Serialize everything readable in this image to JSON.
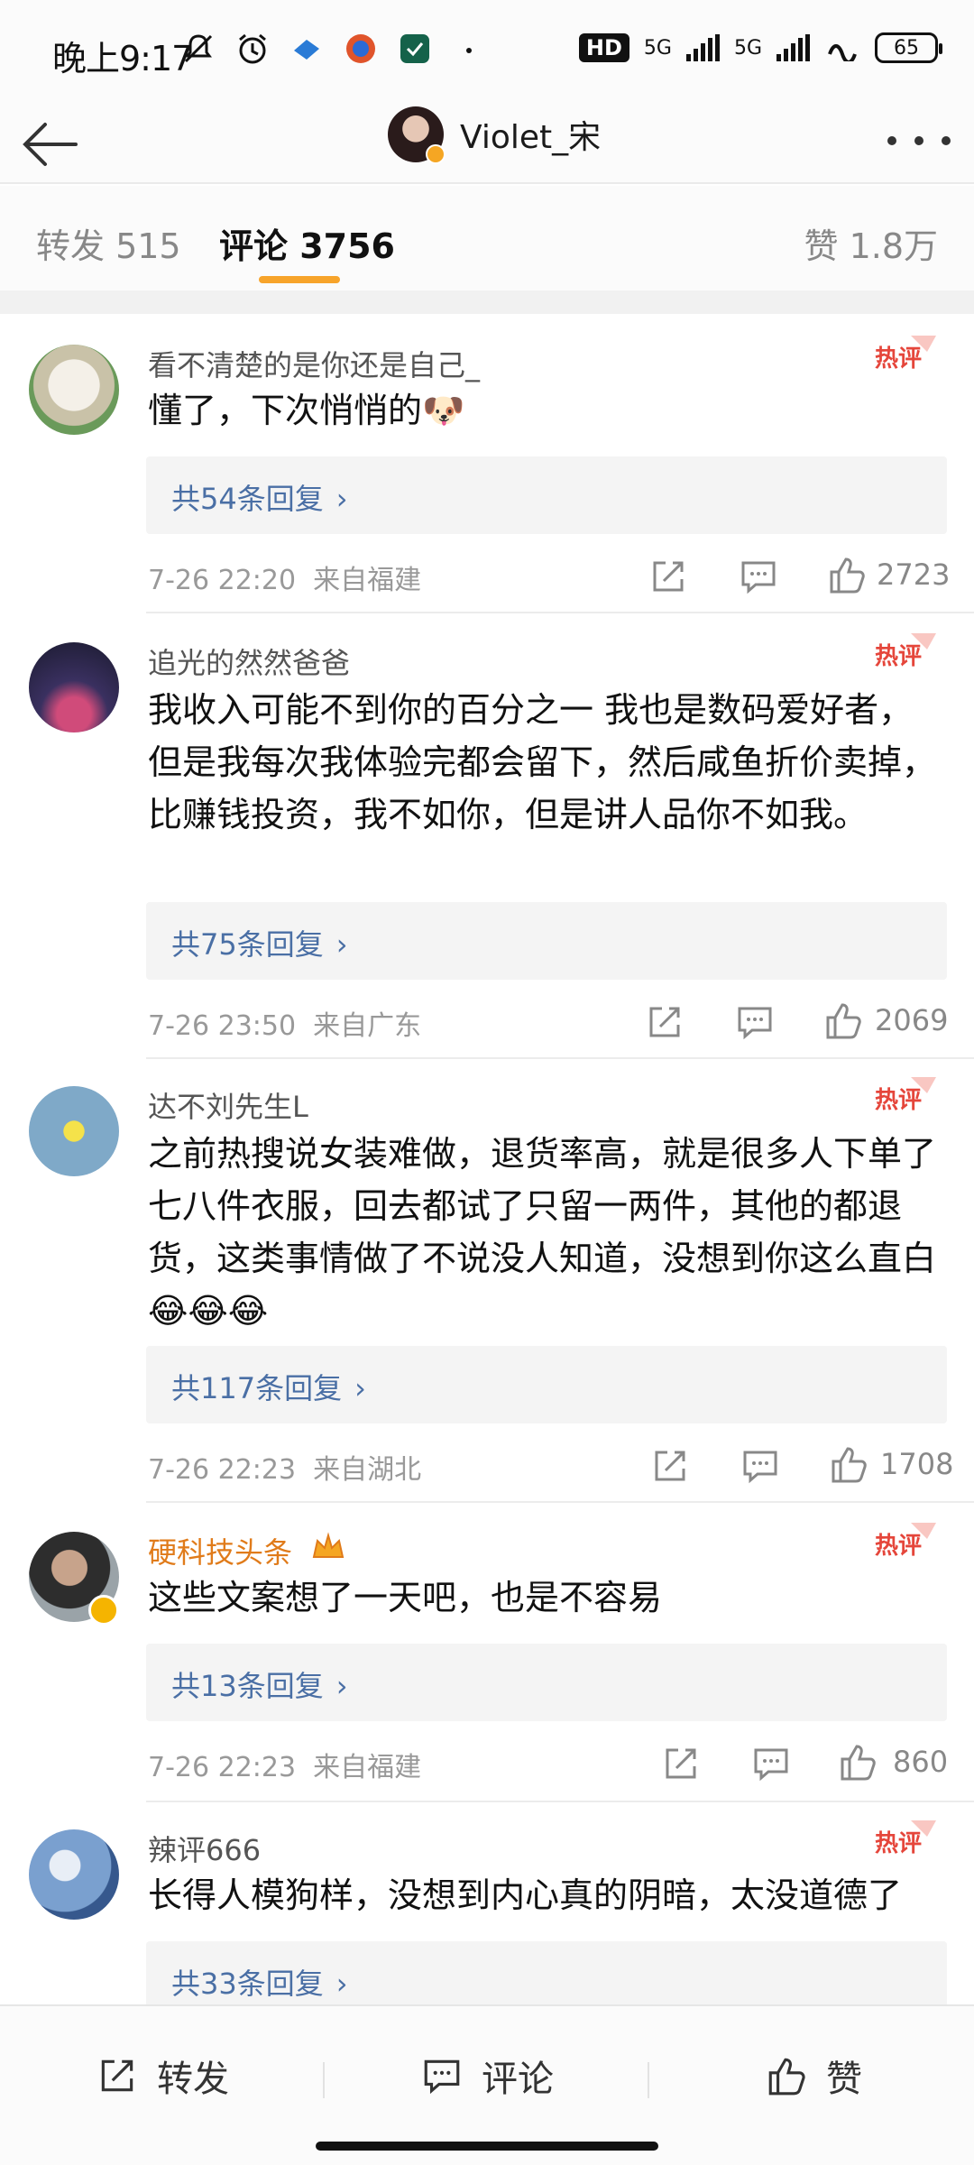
{
  "status_bar": {
    "time": "晚上9:17",
    "network_1": "5G",
    "network_2": "5G",
    "battery": "65",
    "hd_label": "HD"
  },
  "header": {
    "user_name": "Violet_宋"
  },
  "tabs": [
    {
      "label": "转发 515"
    },
    {
      "label": "评论 3756"
    },
    {
      "label": "赞 1.8万"
    }
  ],
  "comments": [
    {
      "user": "看不清楚的是你还是自己_",
      "hot_tag": "热评",
      "text": "懂了，下次悄悄的🐶",
      "replies": "共54条回复",
      "time": "7-26 22:20",
      "location": "来自福建",
      "likes": "2723"
    },
    {
      "user": "追光的然然爸爸",
      "hot_tag": "热评",
      "text": "我收入可能不到你的百分之一 我也是数码爱好者，但是我每次我体验完都会留下，然后咸鱼折价卖掉， 比赚钱投资，我不如你，但是讲人品你不如我。",
      "replies": "共75条回复",
      "time": "7-26 23:50",
      "location": "来自广东",
      "likes": "2069"
    },
    {
      "user": "达不刘先生L",
      "hot_tag": "热评",
      "text": "之前热搜说女装难做，退货率高，就是很多人下单了七八件衣服，回去都试了只留一两件，其他的都退货，这类事情做了不说没人知道，没想到你这么直白😂😂😂",
      "replies": "共117条回复",
      "time": "7-26 22:23",
      "location": "来自湖北",
      "likes": "1708"
    },
    {
      "user": "硬科技头条",
      "hot_tag": "热评",
      "text": "这些文案想了一天吧，也是不容易",
      "replies": "共13条回复",
      "time": "7-26 22:23",
      "location": "来自福建",
      "likes": "860"
    },
    {
      "user": "辣评666",
      "hot_tag": "热评",
      "text": "长得人模狗样，没想到内心真的阴暗，太没道德了",
      "replies": "共33条回复"
    }
  ],
  "bottom_bar": {
    "repost": "转发",
    "comment": "评论",
    "like": "赞"
  },
  "colors": {
    "accent": "#f7a42b",
    "reply_link": "#4a6fa5",
    "hot_tag": "#e5463b"
  }
}
